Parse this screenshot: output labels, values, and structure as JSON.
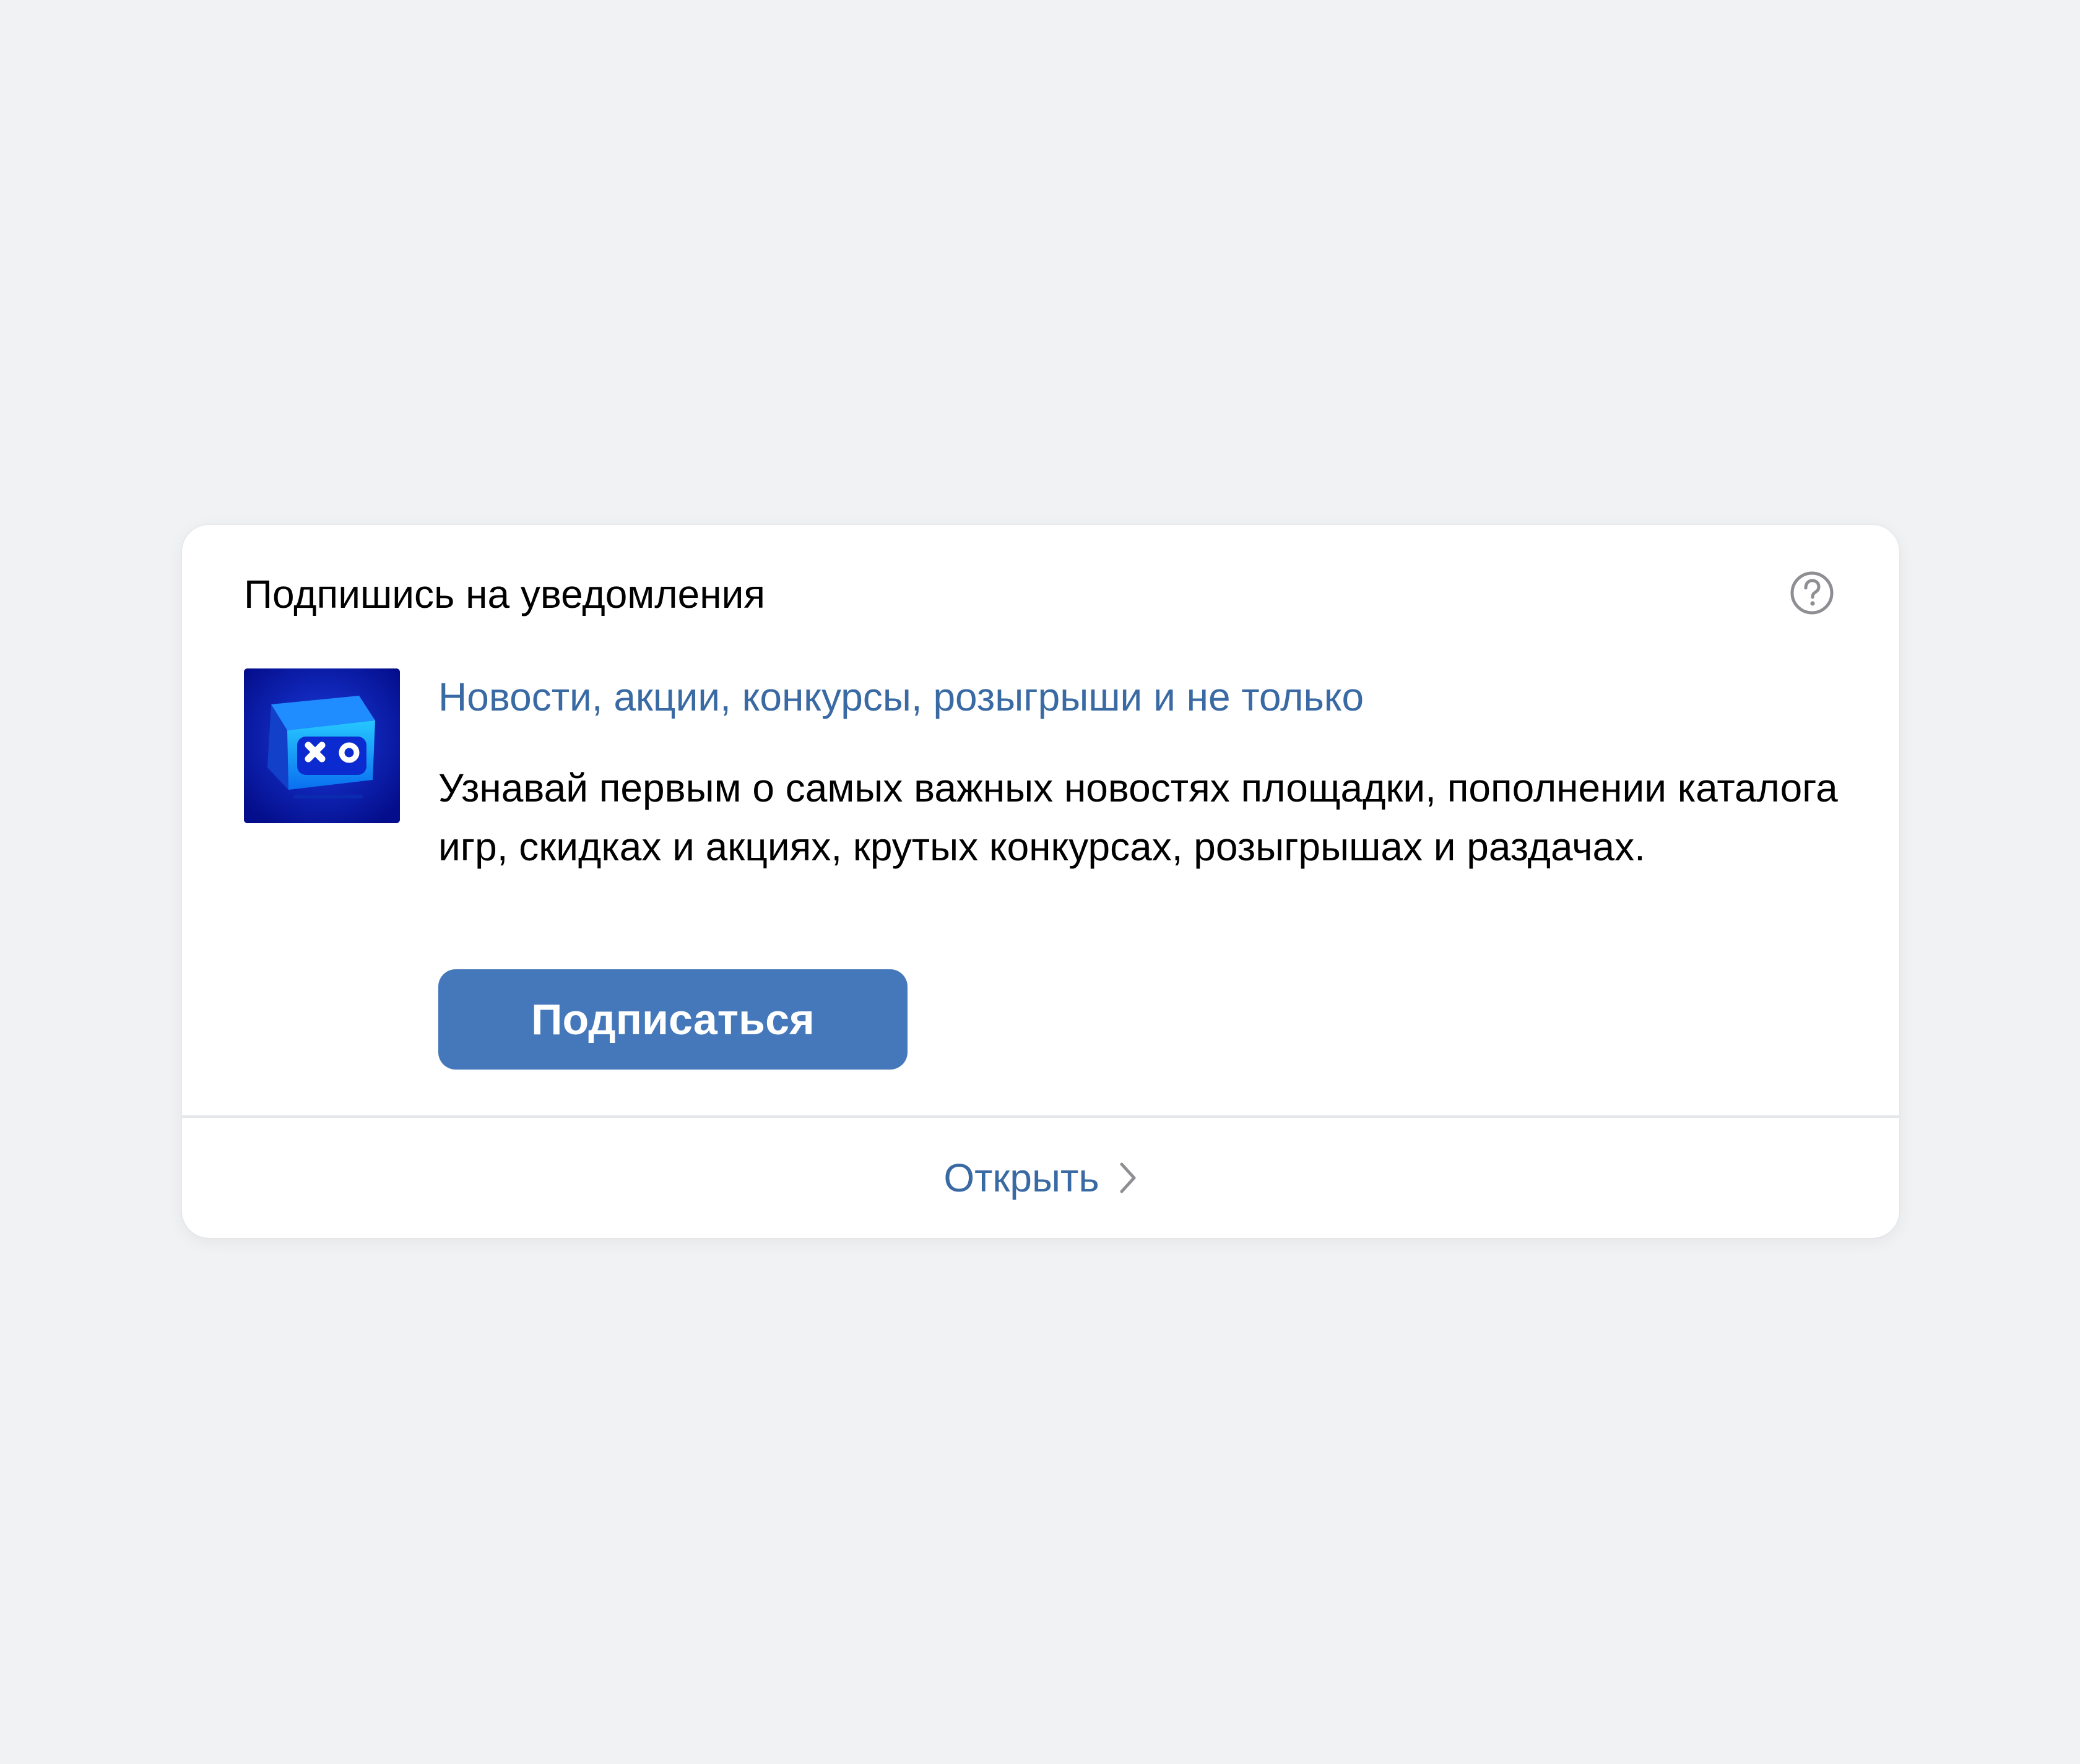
{
  "card": {
    "title": "Подпишись на уведомления",
    "help_icon": "question-circle-icon",
    "avatar_icon": "game-cube-logo",
    "subtitle": "Новости, акции, конкурсы, розыгрыши и не только",
    "description": "Узнавай первым о самых важных новостях площадки, пополнении каталога игр, скидках и акциях, крутых конкурсах, розыгрышах и раздачах.",
    "subscribe_label": "Подписаться",
    "open_label": "Открыть",
    "open_icon": "chevron-right-icon"
  },
  "colors": {
    "page_background": "#f1f2f4",
    "card_background": "#ffffff",
    "link": "#3a6aa3",
    "button": "#4478bb",
    "text": "#000000"
  }
}
